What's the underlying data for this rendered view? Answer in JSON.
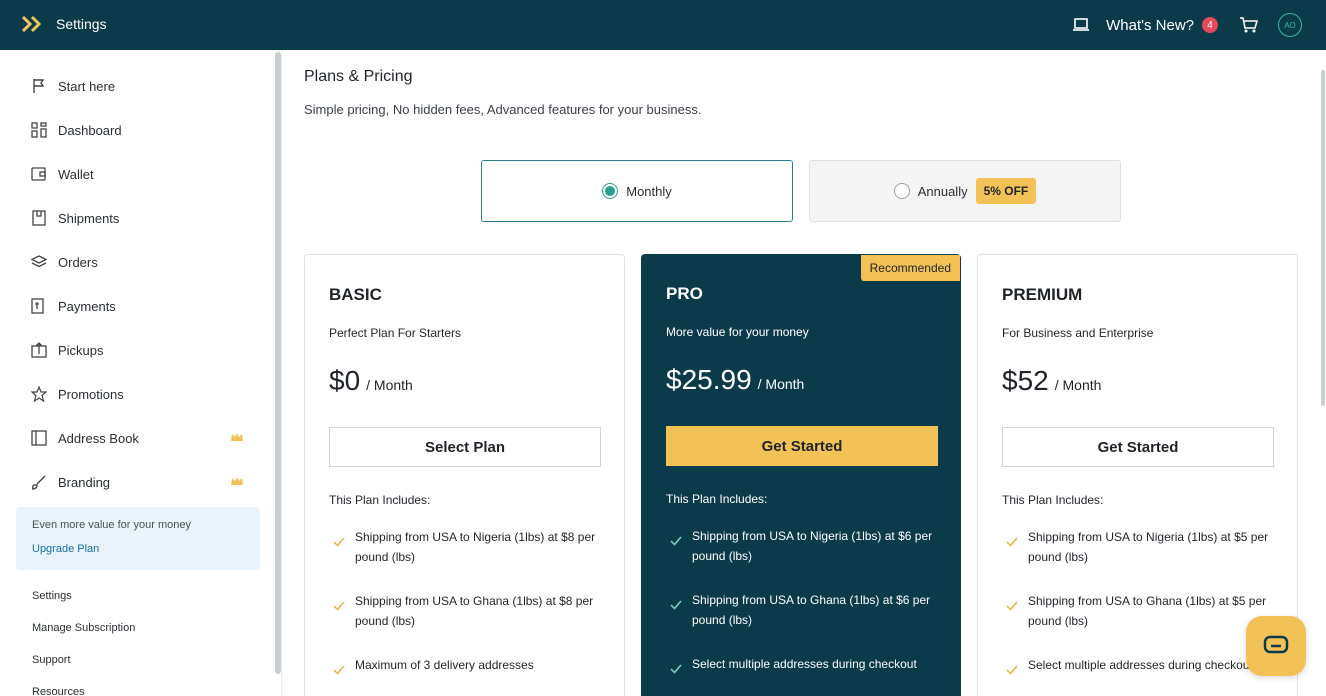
{
  "app": {
    "title": "Settings"
  },
  "topbar": {
    "whats_new": "What's New?",
    "whats_new_count": "4",
    "avatar_initials": "AO"
  },
  "sidebar": {
    "items": [
      {
        "label": "Start here",
        "icon": "flag-icon"
      },
      {
        "label": "Dashboard",
        "icon": "dashboard-icon"
      },
      {
        "label": "Wallet",
        "icon": "wallet-icon"
      },
      {
        "label": "Shipments",
        "icon": "box-icon"
      },
      {
        "label": "Orders",
        "icon": "layers-icon"
      },
      {
        "label": "Payments",
        "icon": "payment-icon"
      },
      {
        "label": "Pickups",
        "icon": "pickup-icon"
      },
      {
        "label": "Promotions",
        "icon": "star-icon"
      },
      {
        "label": "Address Book",
        "icon": "book-icon",
        "premium": true
      },
      {
        "label": "Branding",
        "icon": "brush-icon",
        "premium": true
      }
    ],
    "upgrade": {
      "text": "Even more value for your money",
      "link": "Upgrade Plan"
    },
    "links": [
      "Settings",
      "Manage Subscription",
      "Support",
      "Resources"
    ]
  },
  "main": {
    "title": "Plans & Pricing",
    "subtitle": "Simple pricing, No hidden fees, Advanced features for your business.",
    "billing": {
      "monthly": "Monthly",
      "annually": "Annually",
      "discount": "5% OFF",
      "selected": "Monthly"
    },
    "plans": [
      {
        "name": "BASIC",
        "desc": "Perfect Plan For Starters",
        "price": "$0",
        "per": "/ Month",
        "button": "Select Plan",
        "includes": "This Plan Includes:",
        "features": [
          "Shipping from USA to Nigeria (1lbs) at $8 per pound (lbs)",
          "Shipping from USA to Ghana (1lbs) at $8 per pound (lbs)",
          "Maximum of 3 delivery addresses"
        ]
      },
      {
        "name": "PRO",
        "desc": "More value for your money",
        "price": "$25.99",
        "per": "/ Month",
        "button": "Get Started",
        "includes": "This Plan Includes:",
        "badge": "Recommended",
        "features": [
          "Shipping from USA to Nigeria (1lbs) at $6 per pound (lbs)",
          "Shipping from USA to Ghana (1lbs) at $6 per pound (lbs)",
          "Select multiple addresses during checkout"
        ]
      },
      {
        "name": "PREMIUM",
        "desc": "For Business and Enterprise",
        "price": "$52",
        "per": "/ Month",
        "button": "Get Started",
        "includes": "This Plan Includes:",
        "features": [
          "Shipping from USA to Nigeria (1lbs) at $5 per pound (lbs)",
          "Shipping from USA to Ghana (1lbs) at $5 per pound (lbs)",
          "Select multiple addresses during checkout"
        ]
      }
    ]
  },
  "colors": {
    "brand": "#0b3b4b",
    "accent": "#f3c257",
    "selected": "#2a9d8f"
  }
}
